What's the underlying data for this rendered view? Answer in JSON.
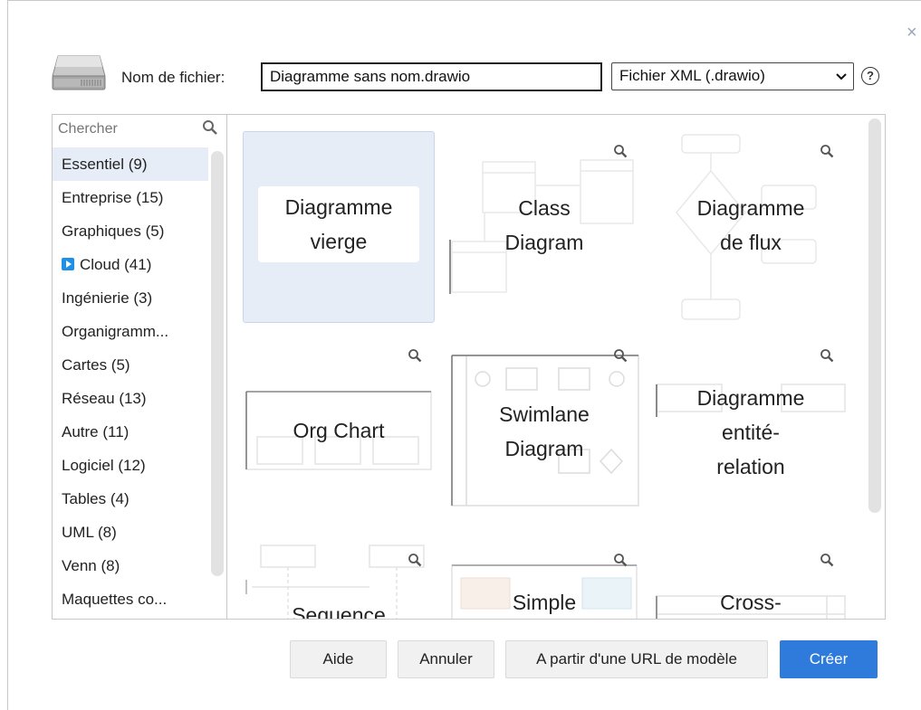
{
  "dialog": {
    "filename_label": "Nom de fichier:",
    "filename_value": "Diagramme sans nom.drawio",
    "format_value": "Fichier XML (.drawio)",
    "help_glyph": "?",
    "close_glyph": "×"
  },
  "search": {
    "placeholder": "Chercher"
  },
  "categories": [
    "Essentiel (9)",
    "Entreprise (15)",
    "Graphiques (5)",
    "Cloud (41)",
    "Ingénierie (3)",
    "Organigramm...",
    "Cartes (5)",
    "Réseau (13)",
    "Autre (11)",
    "Logiciel (12)",
    "Tables (4)",
    "UML (8)",
    "Venn (8)",
    "Maquettes co..."
  ],
  "selected_category": "Essentiel (9)",
  "templates": [
    {
      "line1": "Diagramme",
      "line2": "vierge",
      "line3": ""
    },
    {
      "line1": "Class",
      "line2": "Diagram",
      "line3": ""
    },
    {
      "line1": "Diagramme",
      "line2": "de flux",
      "line3": ""
    },
    {
      "line1": "Org Chart",
      "line2": "",
      "line3": ""
    },
    {
      "line1": "Swimlane",
      "line2": "Diagram",
      "line3": ""
    },
    {
      "line1": "Diagramme",
      "line2": "entité-",
      "line3": "relation"
    },
    {
      "line1": "Sequence",
      "line2": "",
      "line3": ""
    },
    {
      "line1": "Simple",
      "line2": "",
      "line3": ""
    },
    {
      "line1": "Cross-",
      "line2": "",
      "line3": ""
    }
  ],
  "buttons": {
    "help": "Aide",
    "cancel": "Annuler",
    "from_url": "A partir d'une URL de modèle",
    "create": "Créer"
  },
  "colors": {
    "accent": "#2e7bdc",
    "selection": "#e6edf7",
    "cloud_icon": "#1e90e8"
  }
}
